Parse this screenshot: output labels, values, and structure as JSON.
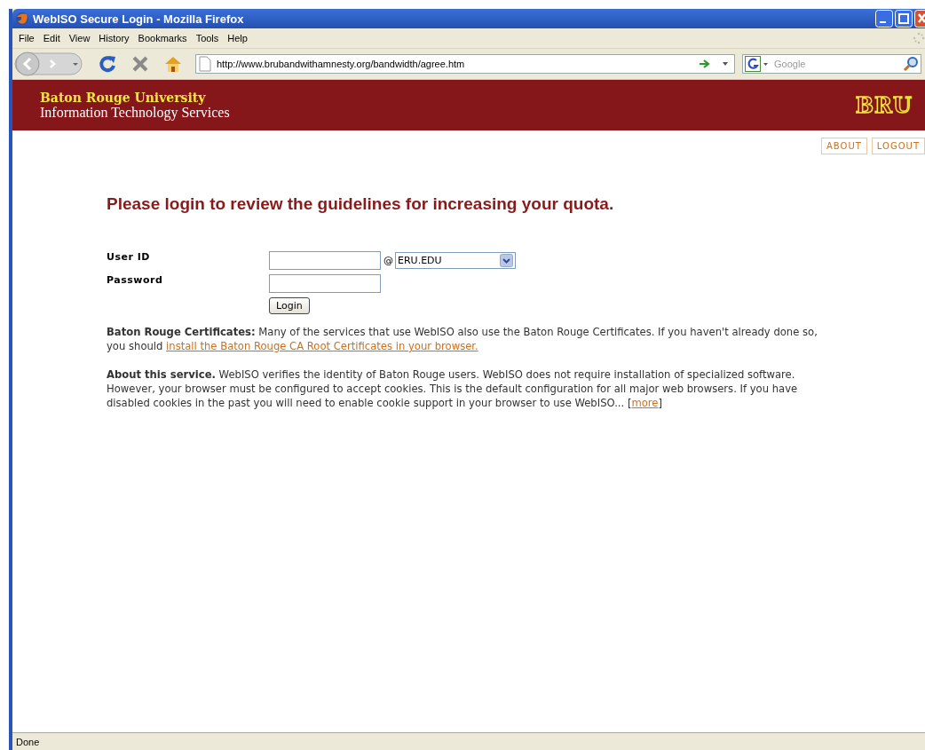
{
  "window": {
    "title": "WebISO Secure Login - Mozilla Firefox"
  },
  "menu": [
    "File",
    "Edit",
    "View",
    "History",
    "Bookmarks",
    "Tools",
    "Help"
  ],
  "toolbar": {
    "url": "http://www.brubandwithamnesty.org/bandwidth/agree.htm",
    "search_placeholder": "Google"
  },
  "banner": {
    "title": "Baton Rouge University",
    "subtitle": "Information Technology Services",
    "logo": "BRU"
  },
  "top_links": [
    "ABOUT",
    "LOGOUT"
  ],
  "heading": "Please login to review the guidelines for increasing your quota.",
  "form": {
    "user_label": "User ID",
    "at": "@",
    "domain": "ERU.EDU",
    "password_label": "Password",
    "button": "Login"
  },
  "paragraphs": [
    {
      "before": "**Baton Rouge Certificates:** Many of the services that use WebISO also use the Baton Rouge Certificates. If you haven't already done so, you should ",
      "link": "install the Baton Rouge CA Root Certificates in your browser."
    },
    {
      "before": "**About this service.** WebISO verifies the identity of Baton Rouge users. WebISO does not require installation of specialized software. However, your browser must be configured to accept cookies. This is the default configuration for all major web browsers. If you have disabled cookies in the past you will need to enable cookie support in your browser to use WebISO... [",
      "link": "more",
      "after": "]"
    }
  ],
  "status_bar": "Done"
}
